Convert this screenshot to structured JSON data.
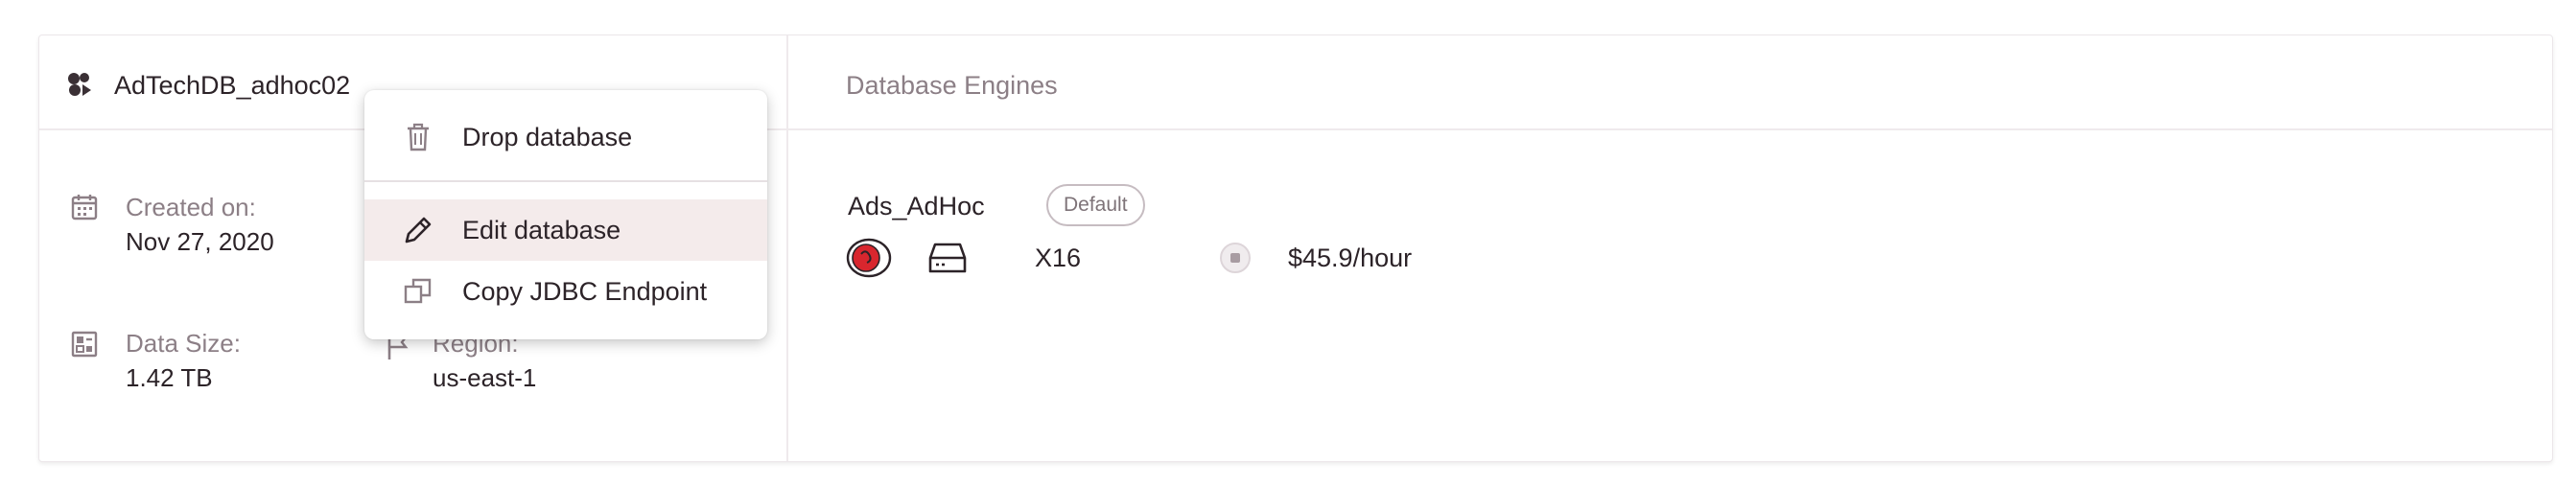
{
  "database": {
    "name": "AdTechDB_adhoc02",
    "created_label": "Created on:",
    "created_value": "Nov 27, 2020",
    "data_size_label": "Data Size:",
    "data_size_value": "1.42 TB",
    "region_label": "Region:",
    "region_value": "us-east-1"
  },
  "engines_panel": {
    "title": "Database Engines",
    "engines": [
      {
        "name": "Ads_AdHoc",
        "badge": "Default",
        "size": "X16",
        "price": "$45.9/hour"
      }
    ]
  },
  "context_menu": {
    "items": [
      {
        "label": "Drop database",
        "icon": "trash-icon"
      },
      {
        "label": "Edit database",
        "icon": "pencil-icon",
        "highlighted": true
      },
      {
        "label": "Copy JDBC Endpoint",
        "icon": "copy-icon"
      }
    ]
  },
  "colors": {
    "text_primary": "#2c2328",
    "text_muted": "#8c7f86",
    "menu_hover": "#f4ebeb",
    "engine_icon_red": "#d8262e",
    "border": "#efeaec"
  }
}
